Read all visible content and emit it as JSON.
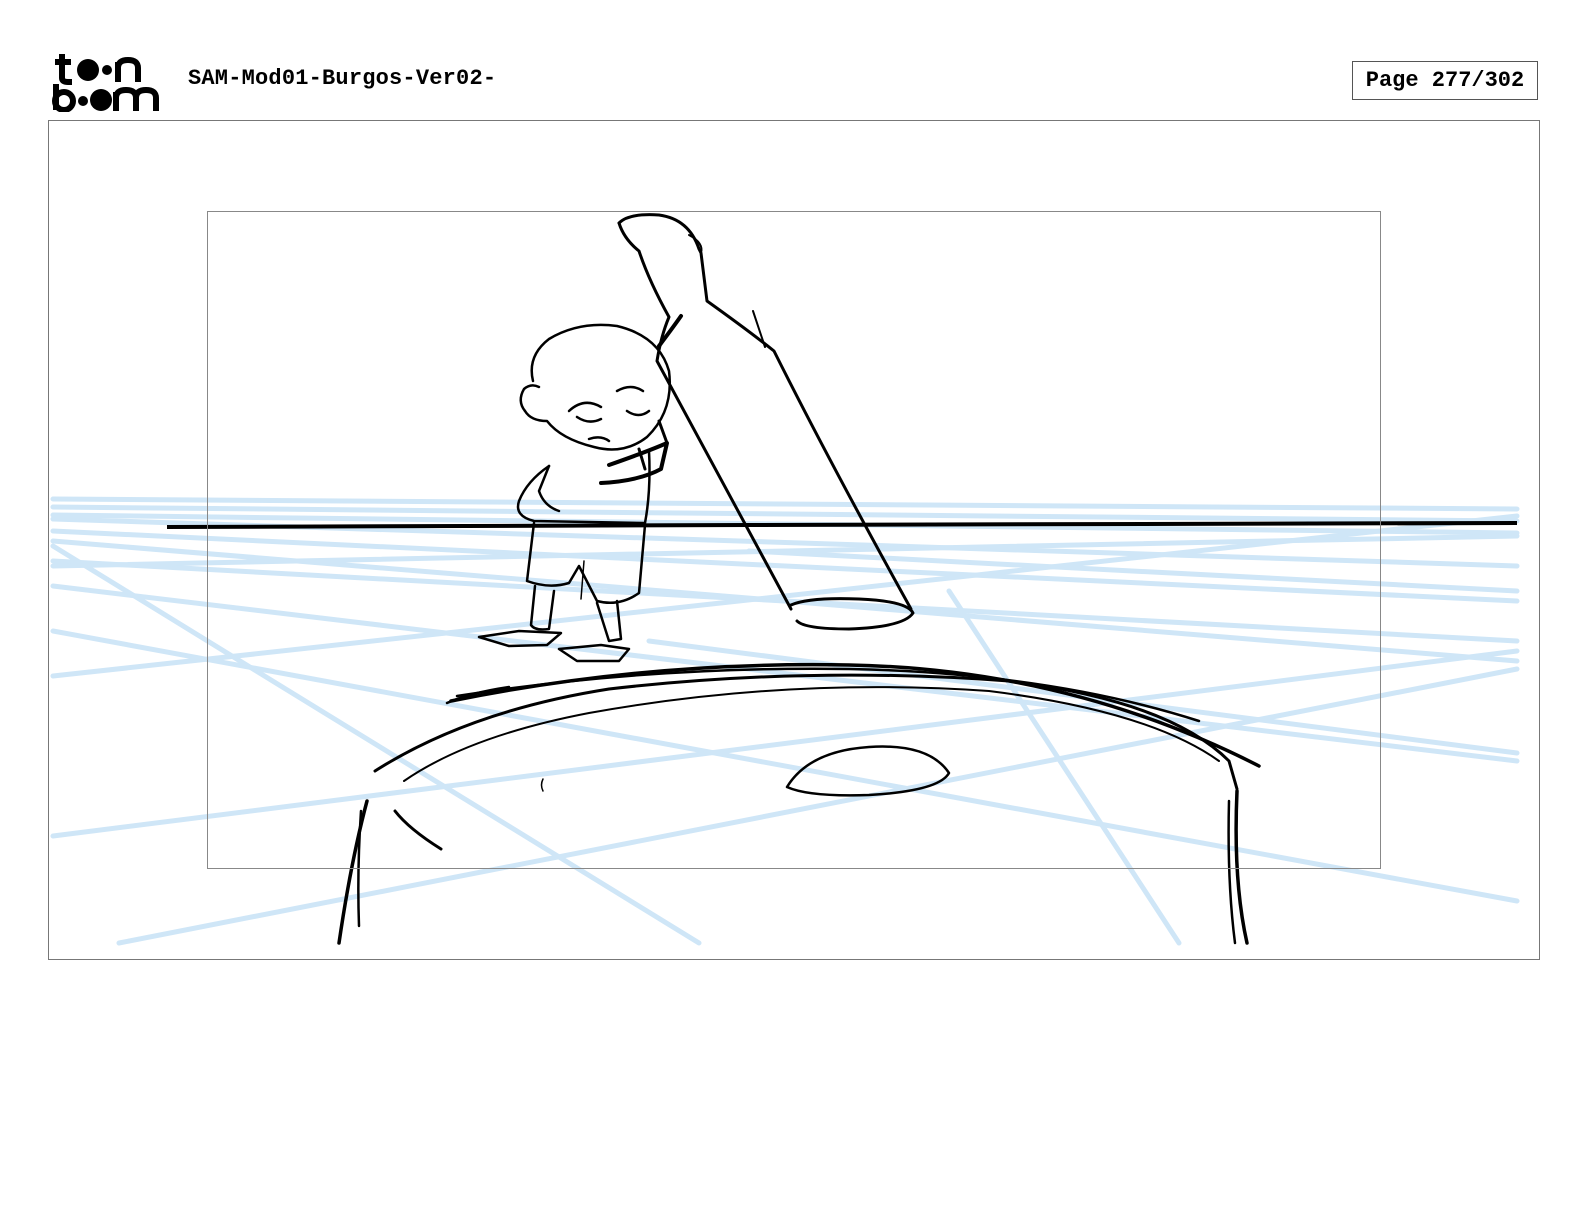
{
  "header": {
    "logo_top": "toon",
    "logo_bottom": "boom",
    "document_title": "SAM-Mod01-Burgos-Ver02-",
    "page_label": "Page 277/302"
  },
  "colors": {
    "guide_lines": "#cfe6f7",
    "ink": "#000000",
    "frame_border": "#888888"
  },
  "panel": {
    "content": "storyboard-sketch"
  }
}
